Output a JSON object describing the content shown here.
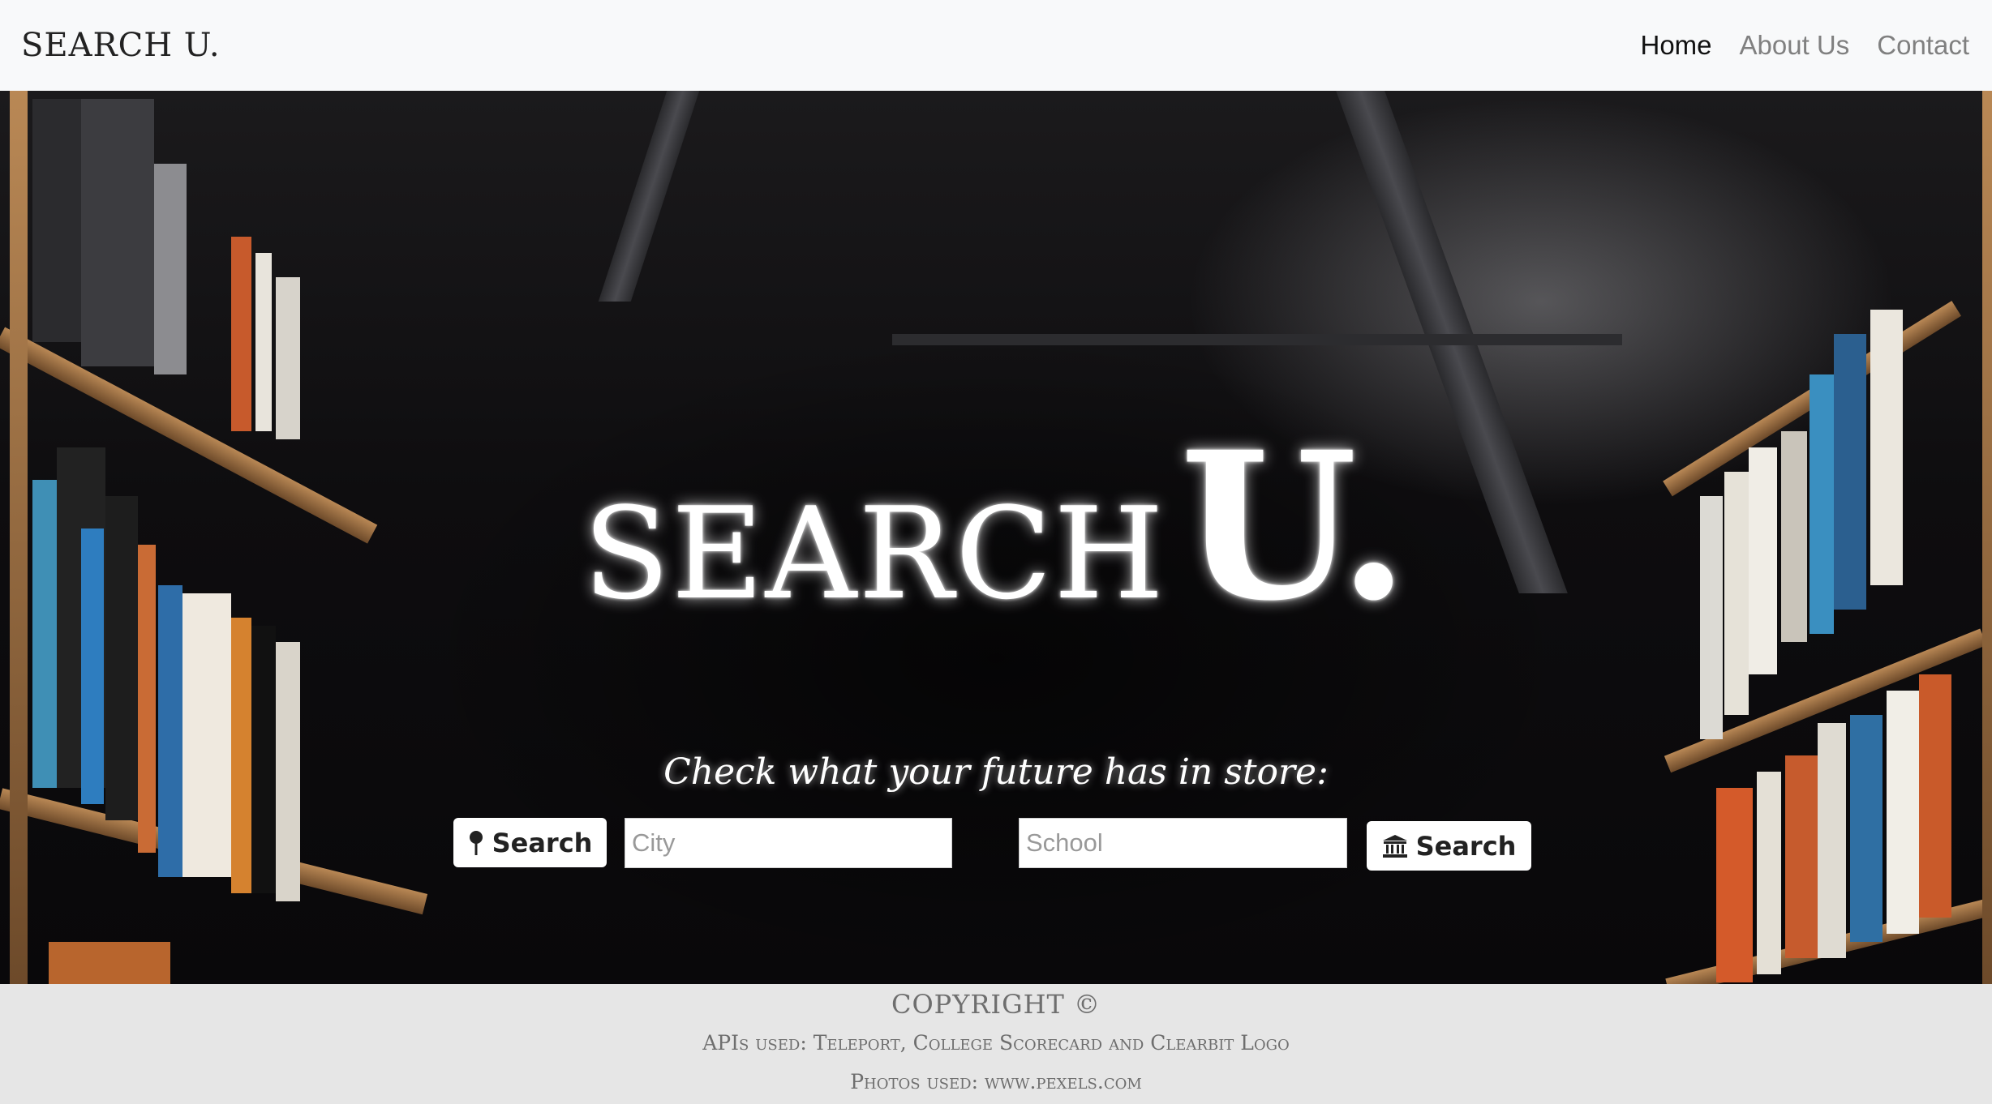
{
  "navbar": {
    "brand": "SEARCH U.",
    "links": [
      {
        "label": "Home",
        "active": true
      },
      {
        "label": "About Us",
        "active": false
      },
      {
        "label": "Contact",
        "active": false
      }
    ]
  },
  "hero": {
    "title_part1": "SEARCH",
    "title_part2": "U.",
    "subtitle": "Check what your future has in store:",
    "city_search": {
      "button_label": "Search",
      "icon": "map-pin-icon",
      "placeholder": "City"
    },
    "school_search": {
      "button_label": "Search",
      "icon": "university-icon",
      "placeholder": "School"
    }
  },
  "footer": {
    "copyright": "COPYRIGHT ©",
    "apis": "APIs used: Teleport, College Scorecard and Clearbit Logo",
    "photos": "Photos used: www.pexels.com"
  },
  "colors": {
    "navbar_bg": "#f8f9fa",
    "footer_bg": "#e6e6e6",
    "nav_active": "#111111",
    "nav_inactive": "#808080"
  }
}
